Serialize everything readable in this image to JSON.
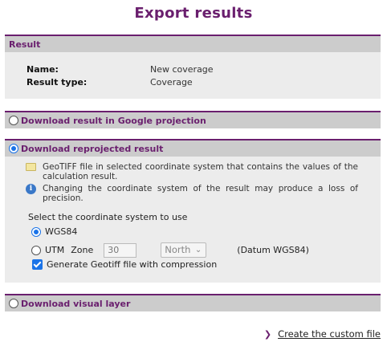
{
  "page": {
    "title": "Export results"
  },
  "result": {
    "heading": "Result",
    "name_label": "Name:",
    "name_value": "New coverage",
    "type_label": "Result type:",
    "type_value": "Coverage"
  },
  "options": {
    "google": {
      "label": "Download result in Google projection",
      "selected": false
    },
    "reprojected": {
      "label": "Download reprojected result",
      "selected": true,
      "info_geotiff": "GeoTIFF file in selected coordinate system that contains the values of the calculation result.",
      "info_warning": "Changing the coordinate system of the result may produce a loss of precision.",
      "select_prompt": "Select the coordinate system to use",
      "wgs84_label": "WGS84",
      "wgs84_selected": true,
      "utm_label": "UTM",
      "utm_selected": false,
      "zone_label": "Zone",
      "zone_value": "30",
      "hemisphere_value": "North",
      "datum_label": "(Datum WGS84)",
      "compression_label": "Generate Geotiff file with compression",
      "compression_checked": true
    },
    "visual": {
      "label": "Download visual layer",
      "selected": false
    }
  },
  "footer": {
    "link_label": "Create the custom file"
  },
  "icons": [
    "folder-icon",
    "info-icon",
    "chevron-down-icon",
    "chevron-right-icon"
  ],
  "colors": {
    "accent": "#6a1f6e",
    "header_bg": "#cccccc",
    "body_bg": "#ececec",
    "control_blue": "#1a73e8"
  }
}
